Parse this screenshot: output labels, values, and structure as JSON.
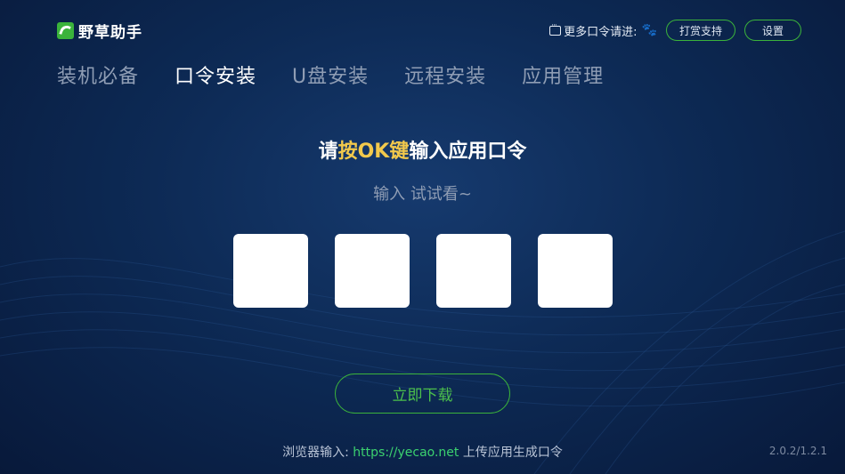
{
  "app": {
    "name": "野草助手"
  },
  "top_bar": {
    "more_hint": "更多口令请进:",
    "reward_button": "打赏支持",
    "settings_button": "设置"
  },
  "nav": {
    "tabs": [
      {
        "label": "装机必备",
        "active": false
      },
      {
        "label": "口令安装",
        "active": true
      },
      {
        "label": "U盘安装",
        "active": false
      },
      {
        "label": "远程安装",
        "active": false
      },
      {
        "label": "应用管理",
        "active": false
      }
    ]
  },
  "main": {
    "headline_prefix": "请",
    "headline_highlight": "按OK键",
    "headline_suffix": "输入应用口令",
    "subline": "输入 试试看~",
    "code_slots": [
      "",
      "",
      "",
      ""
    ],
    "download_button": "立即下载"
  },
  "footer": {
    "prefix": "浏览器输入: ",
    "url": "https://yecao.net",
    "suffix": " 上传应用生成口令",
    "version": "2.0.2/1.2.1"
  },
  "colors": {
    "accent_green": "#3bb33b",
    "highlight_yellow": "#f2c94c",
    "background": "#0d2a55"
  }
}
